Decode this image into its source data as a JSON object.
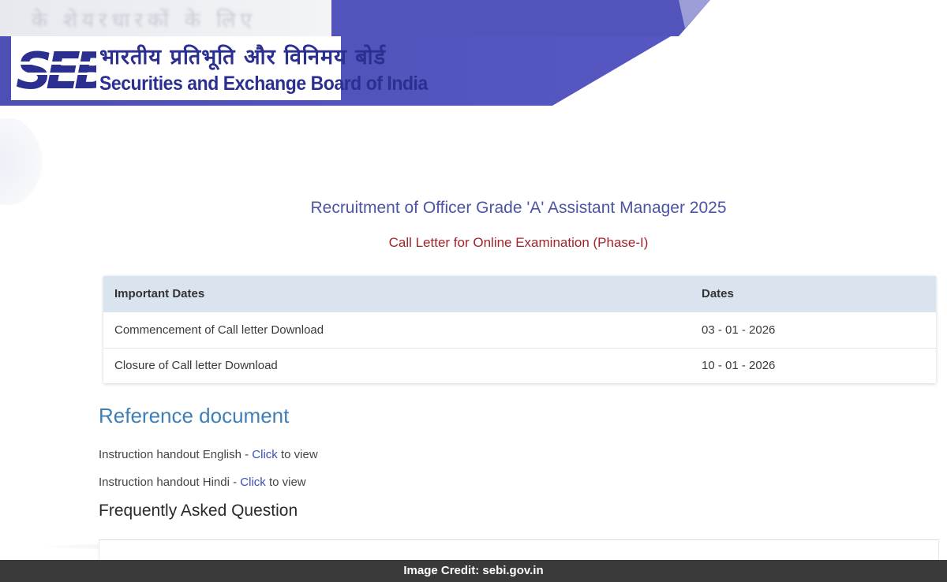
{
  "header": {
    "blurred_text": "के शेयरधारकों के लिए",
    "colors": {
      "band": "#5052b8",
      "logo_text": "#2b2f8f"
    },
    "logo": {
      "mark_text": "SEBI",
      "hindi_name": "भारतीय प्रतिभूति और विनिमय बोर्ड",
      "english_name": "Securities and Exchange Board of India"
    }
  },
  "main": {
    "title": "Recruitment of Officer Grade 'A' Assistant Manager 2025",
    "subtitle": "Call Letter for Online Examination (Phase-I)",
    "dates_table": {
      "headers": [
        "Important Dates",
        "Dates"
      ],
      "rows": [
        {
          "event": "Commencement of Call letter Download",
          "date": "03 - 01 - 2026"
        },
        {
          "event": "Closure of Call letter Download",
          "date": "10 - 01 - 2026"
        }
      ]
    },
    "reference": {
      "heading": "Reference document",
      "items": [
        {
          "prefix": "Instruction handout English - ",
          "link": "Click",
          "suffix": " to view"
        },
        {
          "prefix": "Instruction handout Hindi - ",
          "link": "Click",
          "suffix": " to view"
        }
      ]
    },
    "faq": {
      "heading": "Frequently Asked Question"
    }
  },
  "credit": {
    "text": "Image Credit: sebi.gov.in"
  }
}
